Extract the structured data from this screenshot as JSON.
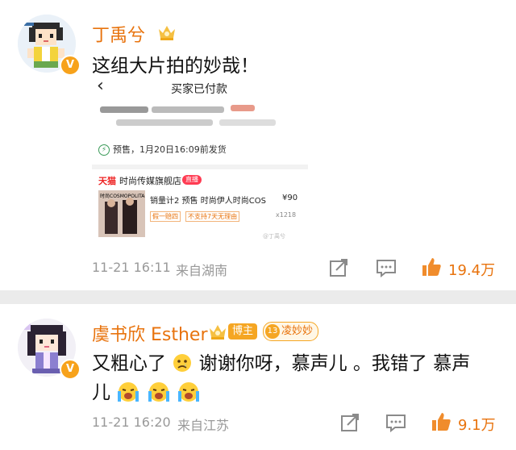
{
  "post1": {
    "username": "丁禹兮",
    "text": "这组大片拍的妙哉！",
    "time": "11-21 16:11",
    "source": "来自湖南",
    "likes": "19.4万",
    "screenshot": {
      "title": "买家已付款",
      "back": "‹",
      "presale": "预售，1月20日16:09前发货",
      "store_brand": "天猫",
      "store_name": "时尚传媒旗舰店",
      "store_tag": "直播",
      "cover_text": "时尚COSMOPOLITAN",
      "product_title": "销量计2 预售 时尚伊人时尚COS",
      "price": "¥90",
      "tag1": "假一赔四",
      "tag2": "不支持7天无理由",
      "quantity": "x1218",
      "watermark": "@丁禹兮"
    }
  },
  "post2": {
    "username": "虞书欣 Esther",
    "badge_blogger": "博主",
    "fan_level": "13",
    "fan_name": "凌妙妙",
    "text_line1": "又粗心了",
    "text_line1b": "谢谢你呀，慕声儿 。我错了 慕声",
    "text_line2": "儿",
    "time": "11-21 16:20",
    "source": "来自江苏",
    "likes": "9.1万"
  },
  "colors": {
    "accent": "#e8730d",
    "vip": "#f7a21b",
    "meta": "#999999"
  },
  "icons": [
    "crown-icon",
    "verified-v-icon",
    "share-icon",
    "comment-icon",
    "like-icon",
    "crying-emoji-icon",
    "sad-emoji-icon"
  ]
}
